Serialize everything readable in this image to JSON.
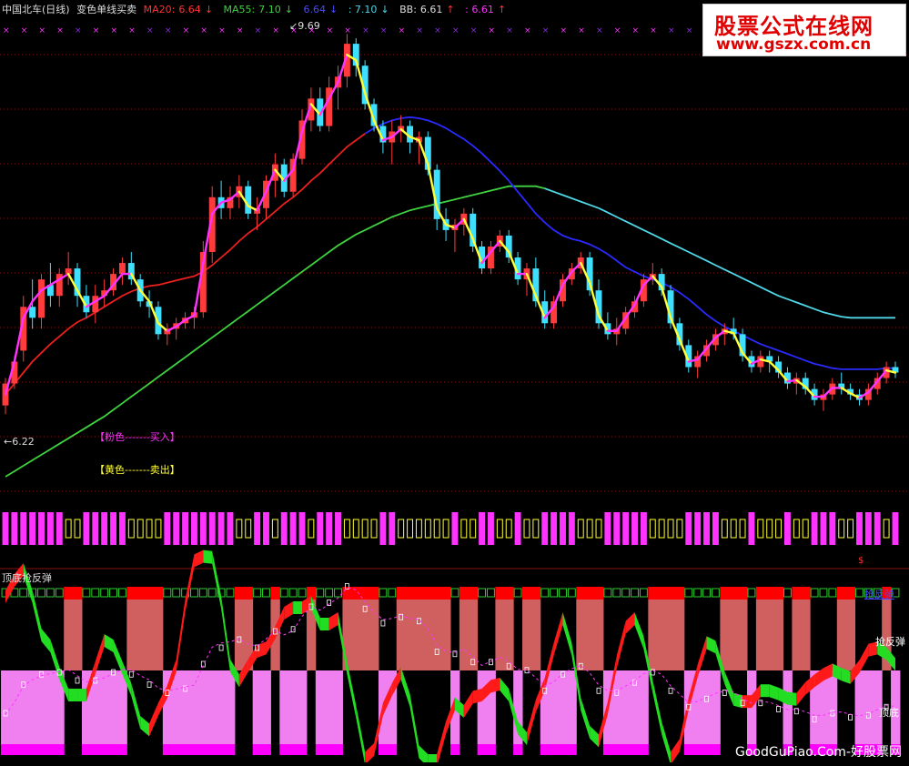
{
  "header": {
    "stock": "中国北车(日线)",
    "indicator": "变色单线买卖",
    "ma20_label": "MA20:",
    "ma20_value": "6.64",
    "ma55_label": "MA55:",
    "ma55_value": "7.10",
    "val3": "6.64",
    "val4": ": 7.10",
    "bb_label": "BB:",
    "bb_value": "6.61",
    "val6": ": 6.61",
    "down_arrow": "↓",
    "up_arrow": "↑"
  },
  "annotations": {
    "high_label": "9.69",
    "low_label": "6.22",
    "buy_legend": "【粉色-------买入】",
    "sell_legend": "【黄色-------卖出】",
    "dollar": "$"
  },
  "lower_panel": {
    "title": "顶底抢反弹",
    "label_right_top": "抢反弹",
    "label_right_mid": "抢反弹",
    "label_right_low": "顶底"
  },
  "watermark": {
    "line1": "股票公式在线网",
    "line2": "www.gszx.com.cn",
    "footer": "GoodGuPiao.Com-好股票网"
  },
  "colors": {
    "bg": "#000000",
    "up": "#ff3b3b",
    "down": "#3fe0ff",
    "ma20": "#e8201e",
    "ma55": "#2a2aff",
    "ma_long": "#3fd23f",
    "ma_long2": "#4fd8e8",
    "signal_buy": "#ff33ff",
    "signal_sell": "#ffff33",
    "ribbon_up": "#ff1a1a",
    "ribbon_down": "#22dd22",
    "band_top": "#d06060",
    "band_bottom": "#f080f0",
    "band_red": "#ff0000",
    "band_magenta": "#ff00ff",
    "grid": "#8a1010"
  },
  "chart_data": {
    "type": "candlestick",
    "price_range": [
      5.6,
      9.85
    ],
    "high": 9.69,
    "low": 6.22,
    "ohlc": [
      [
        6.3,
        6.55,
        6.22,
        6.5
      ],
      [
        6.5,
        6.75,
        6.45,
        6.7
      ],
      [
        6.8,
        7.3,
        6.7,
        7.2
      ],
      [
        7.2,
        7.45,
        7.0,
        7.1
      ],
      [
        7.1,
        7.5,
        7.0,
        7.45
      ],
      [
        7.4,
        7.6,
        7.2,
        7.3
      ],
      [
        7.3,
        7.55,
        7.2,
        7.5
      ],
      [
        7.5,
        7.7,
        7.4,
        7.55
      ],
      [
        7.55,
        7.6,
        7.2,
        7.3
      ],
      [
        7.3,
        7.4,
        7.1,
        7.15
      ],
      [
        7.15,
        7.4,
        7.05,
        7.3
      ],
      [
        7.3,
        7.45,
        7.2,
        7.35
      ],
      [
        7.35,
        7.55,
        7.3,
        7.5
      ],
      [
        7.5,
        7.65,
        7.4,
        7.6
      ],
      [
        7.6,
        7.7,
        7.4,
        7.45
      ],
      [
        7.45,
        7.5,
        7.2,
        7.25
      ],
      [
        7.25,
        7.35,
        7.1,
        7.2
      ],
      [
        7.2,
        7.25,
        6.9,
        6.95
      ],
      [
        6.95,
        7.05,
        6.85,
        7.0
      ],
      [
        7.0,
        7.1,
        6.9,
        7.05
      ],
      [
        7.05,
        7.15,
        7.0,
        7.1
      ],
      [
        7.1,
        7.2,
        7.0,
        7.15
      ],
      [
        7.15,
        7.8,
        7.1,
        7.7
      ],
      [
        7.7,
        8.3,
        7.6,
        8.2
      ],
      [
        8.2,
        8.35,
        8.0,
        8.1
      ],
      [
        8.1,
        8.3,
        8.0,
        8.2
      ],
      [
        8.2,
        8.4,
        8.1,
        8.3
      ],
      [
        8.3,
        8.35,
        8.0,
        8.05
      ],
      [
        8.05,
        8.2,
        7.9,
        8.1
      ],
      [
        8.1,
        8.4,
        8.0,
        8.35
      ],
      [
        8.35,
        8.6,
        8.2,
        8.5
      ],
      [
        8.5,
        8.55,
        8.2,
        8.25
      ],
      [
        8.25,
        8.6,
        8.2,
        8.55
      ],
      [
        8.55,
        9.0,
        8.5,
        8.9
      ],
      [
        8.9,
        9.2,
        8.8,
        9.1
      ],
      [
        9.1,
        9.2,
        8.8,
        8.85
      ],
      [
        8.85,
        9.3,
        8.8,
        9.2
      ],
      [
        9.2,
        9.4,
        9.0,
        9.3
      ],
      [
        9.3,
        9.69,
        9.2,
        9.6
      ],
      [
        9.6,
        9.65,
        9.3,
        9.4
      ],
      [
        9.4,
        9.45,
        9.0,
        9.05
      ],
      [
        9.05,
        9.1,
        8.8,
        8.85
      ],
      [
        8.85,
        8.9,
        8.6,
        8.7
      ],
      [
        8.7,
        8.9,
        8.5,
        8.8
      ],
      [
        8.8,
        8.95,
        8.7,
        8.85
      ],
      [
        8.85,
        8.9,
        8.6,
        8.7
      ],
      [
        8.7,
        8.8,
        8.5,
        8.75
      ],
      [
        8.75,
        8.8,
        8.4,
        8.45
      ],
      [
        8.45,
        8.5,
        7.9,
        8.0
      ],
      [
        8.0,
        8.1,
        7.8,
        7.9
      ],
      [
        7.9,
        8.0,
        7.7,
        7.95
      ],
      [
        7.95,
        8.1,
        7.85,
        8.05
      ],
      [
        8.05,
        8.1,
        7.7,
        7.75
      ],
      [
        7.75,
        7.8,
        7.5,
        7.55
      ],
      [
        7.55,
        7.8,
        7.5,
        7.75
      ],
      [
        7.75,
        7.9,
        7.7,
        7.85
      ],
      [
        7.85,
        7.9,
        7.6,
        7.65
      ],
      [
        7.65,
        7.7,
        7.4,
        7.45
      ],
      [
        7.45,
        7.6,
        7.3,
        7.55
      ],
      [
        7.55,
        7.65,
        7.2,
        7.25
      ],
      [
        7.25,
        7.35,
        7.0,
        7.05
      ],
      [
        7.05,
        7.3,
        7.0,
        7.25
      ],
      [
        7.25,
        7.5,
        7.2,
        7.45
      ],
      [
        7.45,
        7.6,
        7.4,
        7.55
      ],
      [
        7.55,
        7.7,
        7.5,
        7.65
      ],
      [
        7.65,
        7.7,
        7.3,
        7.35
      ],
      [
        7.35,
        7.45,
        7.0,
        7.05
      ],
      [
        7.05,
        7.15,
        6.9,
        6.95
      ],
      [
        6.95,
        7.1,
        6.85,
        7.0
      ],
      [
        7.0,
        7.2,
        6.95,
        7.15
      ],
      [
        7.15,
        7.3,
        7.1,
        7.25
      ],
      [
        7.25,
        7.5,
        7.2,
        7.45
      ],
      [
        7.45,
        7.6,
        7.4,
        7.5
      ],
      [
        7.5,
        7.55,
        7.3,
        7.35
      ],
      [
        7.35,
        7.4,
        7.0,
        7.05
      ],
      [
        7.05,
        7.1,
        6.8,
        6.85
      ],
      [
        6.85,
        6.9,
        6.6,
        6.65
      ],
      [
        6.65,
        6.8,
        6.55,
        6.75
      ],
      [
        6.75,
        6.9,
        6.7,
        6.85
      ],
      [
        6.85,
        7.0,
        6.8,
        6.95
      ],
      [
        6.95,
        7.05,
        6.85,
        7.0
      ],
      [
        7.0,
        7.1,
        6.9,
        6.95
      ],
      [
        6.95,
        7.0,
        6.7,
        6.75
      ],
      [
        6.75,
        6.8,
        6.6,
        6.65
      ],
      [
        6.65,
        6.8,
        6.6,
        6.75
      ],
      [
        6.75,
        6.8,
        6.6,
        6.7
      ],
      [
        6.7,
        6.75,
        6.55,
        6.6
      ],
      [
        6.6,
        6.65,
        6.45,
        6.5
      ],
      [
        6.5,
        6.6,
        6.4,
        6.55
      ],
      [
        6.55,
        6.6,
        6.4,
        6.45
      ],
      [
        6.45,
        6.5,
        6.3,
        6.35
      ],
      [
        6.35,
        6.45,
        6.25,
        6.4
      ],
      [
        6.4,
        6.55,
        6.35,
        6.5
      ],
      [
        6.5,
        6.6,
        6.4,
        6.45
      ],
      [
        6.45,
        6.5,
        6.35,
        6.4
      ],
      [
        6.4,
        6.45,
        6.3,
        6.35
      ],
      [
        6.35,
        6.5,
        6.3,
        6.45
      ],
      [
        6.45,
        6.6,
        6.4,
        6.55
      ],
      [
        6.55,
        6.7,
        6.5,
        6.65
      ],
      [
        6.65,
        6.7,
        6.55,
        6.6
      ]
    ],
    "ma20": [
      6.4,
      6.5,
      6.6,
      6.7,
      6.78,
      6.86,
      6.93,
      7.0,
      7.06,
      7.1,
      7.15,
      7.2,
      7.25,
      7.3,
      7.34,
      7.37,
      7.39,
      7.4,
      7.42,
      7.44,
      7.46,
      7.48,
      7.52,
      7.58,
      7.65,
      7.72,
      7.8,
      7.87,
      7.93,
      8.0,
      8.07,
      8.14,
      8.2,
      8.27,
      8.35,
      8.42,
      8.5,
      8.58,
      8.66,
      8.72,
      8.78,
      8.83,
      8.87,
      8.9,
      8.92,
      8.93,
      8.92,
      8.9,
      8.87,
      8.83,
      8.78,
      8.73,
      8.67,
      8.6,
      8.52,
      8.44,
      8.35,
      8.25,
      8.15,
      8.05,
      7.97,
      7.9,
      7.85,
      7.82,
      7.8,
      7.77,
      7.73,
      7.68,
      7.62,
      7.56,
      7.52,
      7.48,
      7.45,
      7.42,
      7.38,
      7.33,
      7.27,
      7.2,
      7.13,
      7.07,
      7.02,
      6.98,
      6.94,
      6.9,
      6.86,
      6.83,
      6.8,
      6.77,
      6.74,
      6.71,
      6.68,
      6.66,
      6.64,
      6.63,
      6.63,
      6.63,
      6.63,
      6.63,
      6.64,
      6.64
    ],
    "ma55": [
      5.65,
      5.7,
      5.75,
      5.8,
      5.85,
      5.9,
      5.95,
      6.0,
      6.05,
      6.1,
      6.15,
      6.2,
      6.26,
      6.32,
      6.38,
      6.44,
      6.5,
      6.56,
      6.62,
      6.68,
      6.74,
      6.8,
      6.86,
      6.92,
      6.98,
      7.04,
      7.1,
      7.16,
      7.22,
      7.28,
      7.34,
      7.4,
      7.46,
      7.52,
      7.58,
      7.64,
      7.7,
      7.76,
      7.81,
      7.86,
      7.9,
      7.94,
      7.98,
      8.02,
      8.05,
      8.08,
      8.1,
      8.12,
      8.14,
      8.16,
      8.18,
      8.2,
      8.22,
      8.24,
      8.26,
      8.28,
      8.3,
      8.3,
      8.3,
      8.3,
      8.28,
      8.25,
      8.22,
      8.19,
      8.16,
      8.13,
      8.1,
      8.06,
      8.02,
      7.98,
      7.94,
      7.9,
      7.86,
      7.82,
      7.78,
      7.74,
      7.7,
      7.66,
      7.62,
      7.58,
      7.54,
      7.5,
      7.46,
      7.42,
      7.38,
      7.34,
      7.3,
      7.27,
      7.24,
      7.21,
      7.18,
      7.15,
      7.13,
      7.11,
      7.1,
      7.1,
      7.1,
      7.1,
      7.1,
      7.1
    ],
    "signal_line": [
      6.4,
      6.7,
      7.1,
      7.25,
      7.35,
      7.4,
      7.45,
      7.5,
      7.35,
      7.2,
      7.25,
      7.3,
      7.4,
      7.5,
      7.5,
      7.35,
      7.25,
      7.05,
      6.98,
      7.02,
      7.08,
      7.12,
      7.6,
      8.05,
      8.15,
      8.18,
      8.25,
      8.12,
      8.08,
      8.25,
      8.45,
      8.35,
      8.45,
      8.8,
      9.05,
      8.95,
      9.1,
      9.25,
      9.5,
      9.45,
      9.15,
      8.9,
      8.72,
      8.75,
      8.82,
      8.75,
      8.72,
      8.5,
      8.1,
      7.95,
      7.92,
      8.0,
      7.82,
      7.6,
      7.7,
      7.8,
      7.7,
      7.5,
      7.5,
      7.3,
      7.1,
      7.2,
      7.4,
      7.52,
      7.6,
      7.42,
      7.12,
      6.98,
      6.98,
      7.1,
      7.22,
      7.4,
      7.48,
      7.38,
      7.1,
      6.9,
      6.7,
      6.72,
      6.82,
      6.92,
      6.98,
      6.96,
      6.78,
      6.68,
      6.72,
      6.7,
      6.62,
      6.52,
      6.53,
      6.47,
      6.38,
      6.38,
      6.46,
      6.46,
      6.41,
      6.37,
      6.42,
      6.52,
      6.62,
      6.6
    ]
  }
}
